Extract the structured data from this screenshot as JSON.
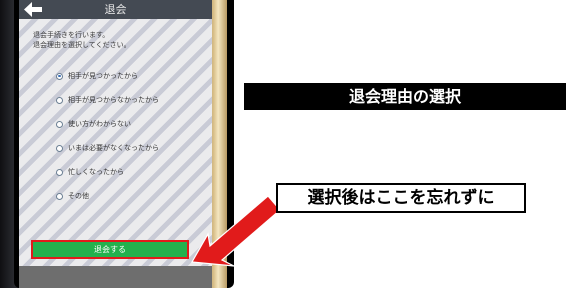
{
  "screen": {
    "title": "退会",
    "intro_lines": [
      "退会手続きを行います。",
      "退会理由を選択してください。"
    ],
    "reasons": [
      {
        "label": "相手が見つかったから",
        "selected": true
      },
      {
        "label": "相手が見つからなかったから",
        "selected": false
      },
      {
        "label": "使い方がわからない",
        "selected": false
      },
      {
        "label": "いまは必要がなくなったから",
        "selected": false
      },
      {
        "label": "忙しくなったから",
        "selected": false
      },
      {
        "label": "その他",
        "selected": false
      }
    ],
    "submit_label": "退会する"
  },
  "annotations": {
    "heading": "退会理由の選択",
    "callout": "選択後はここを忘れずに"
  },
  "colors": {
    "submit_green": "#23b14d",
    "highlight_red": "#e11b1b",
    "title_bar": "#444a53"
  },
  "icons": {
    "back": "back-arrow-icon",
    "pointer": "red-arrow-icon"
  }
}
